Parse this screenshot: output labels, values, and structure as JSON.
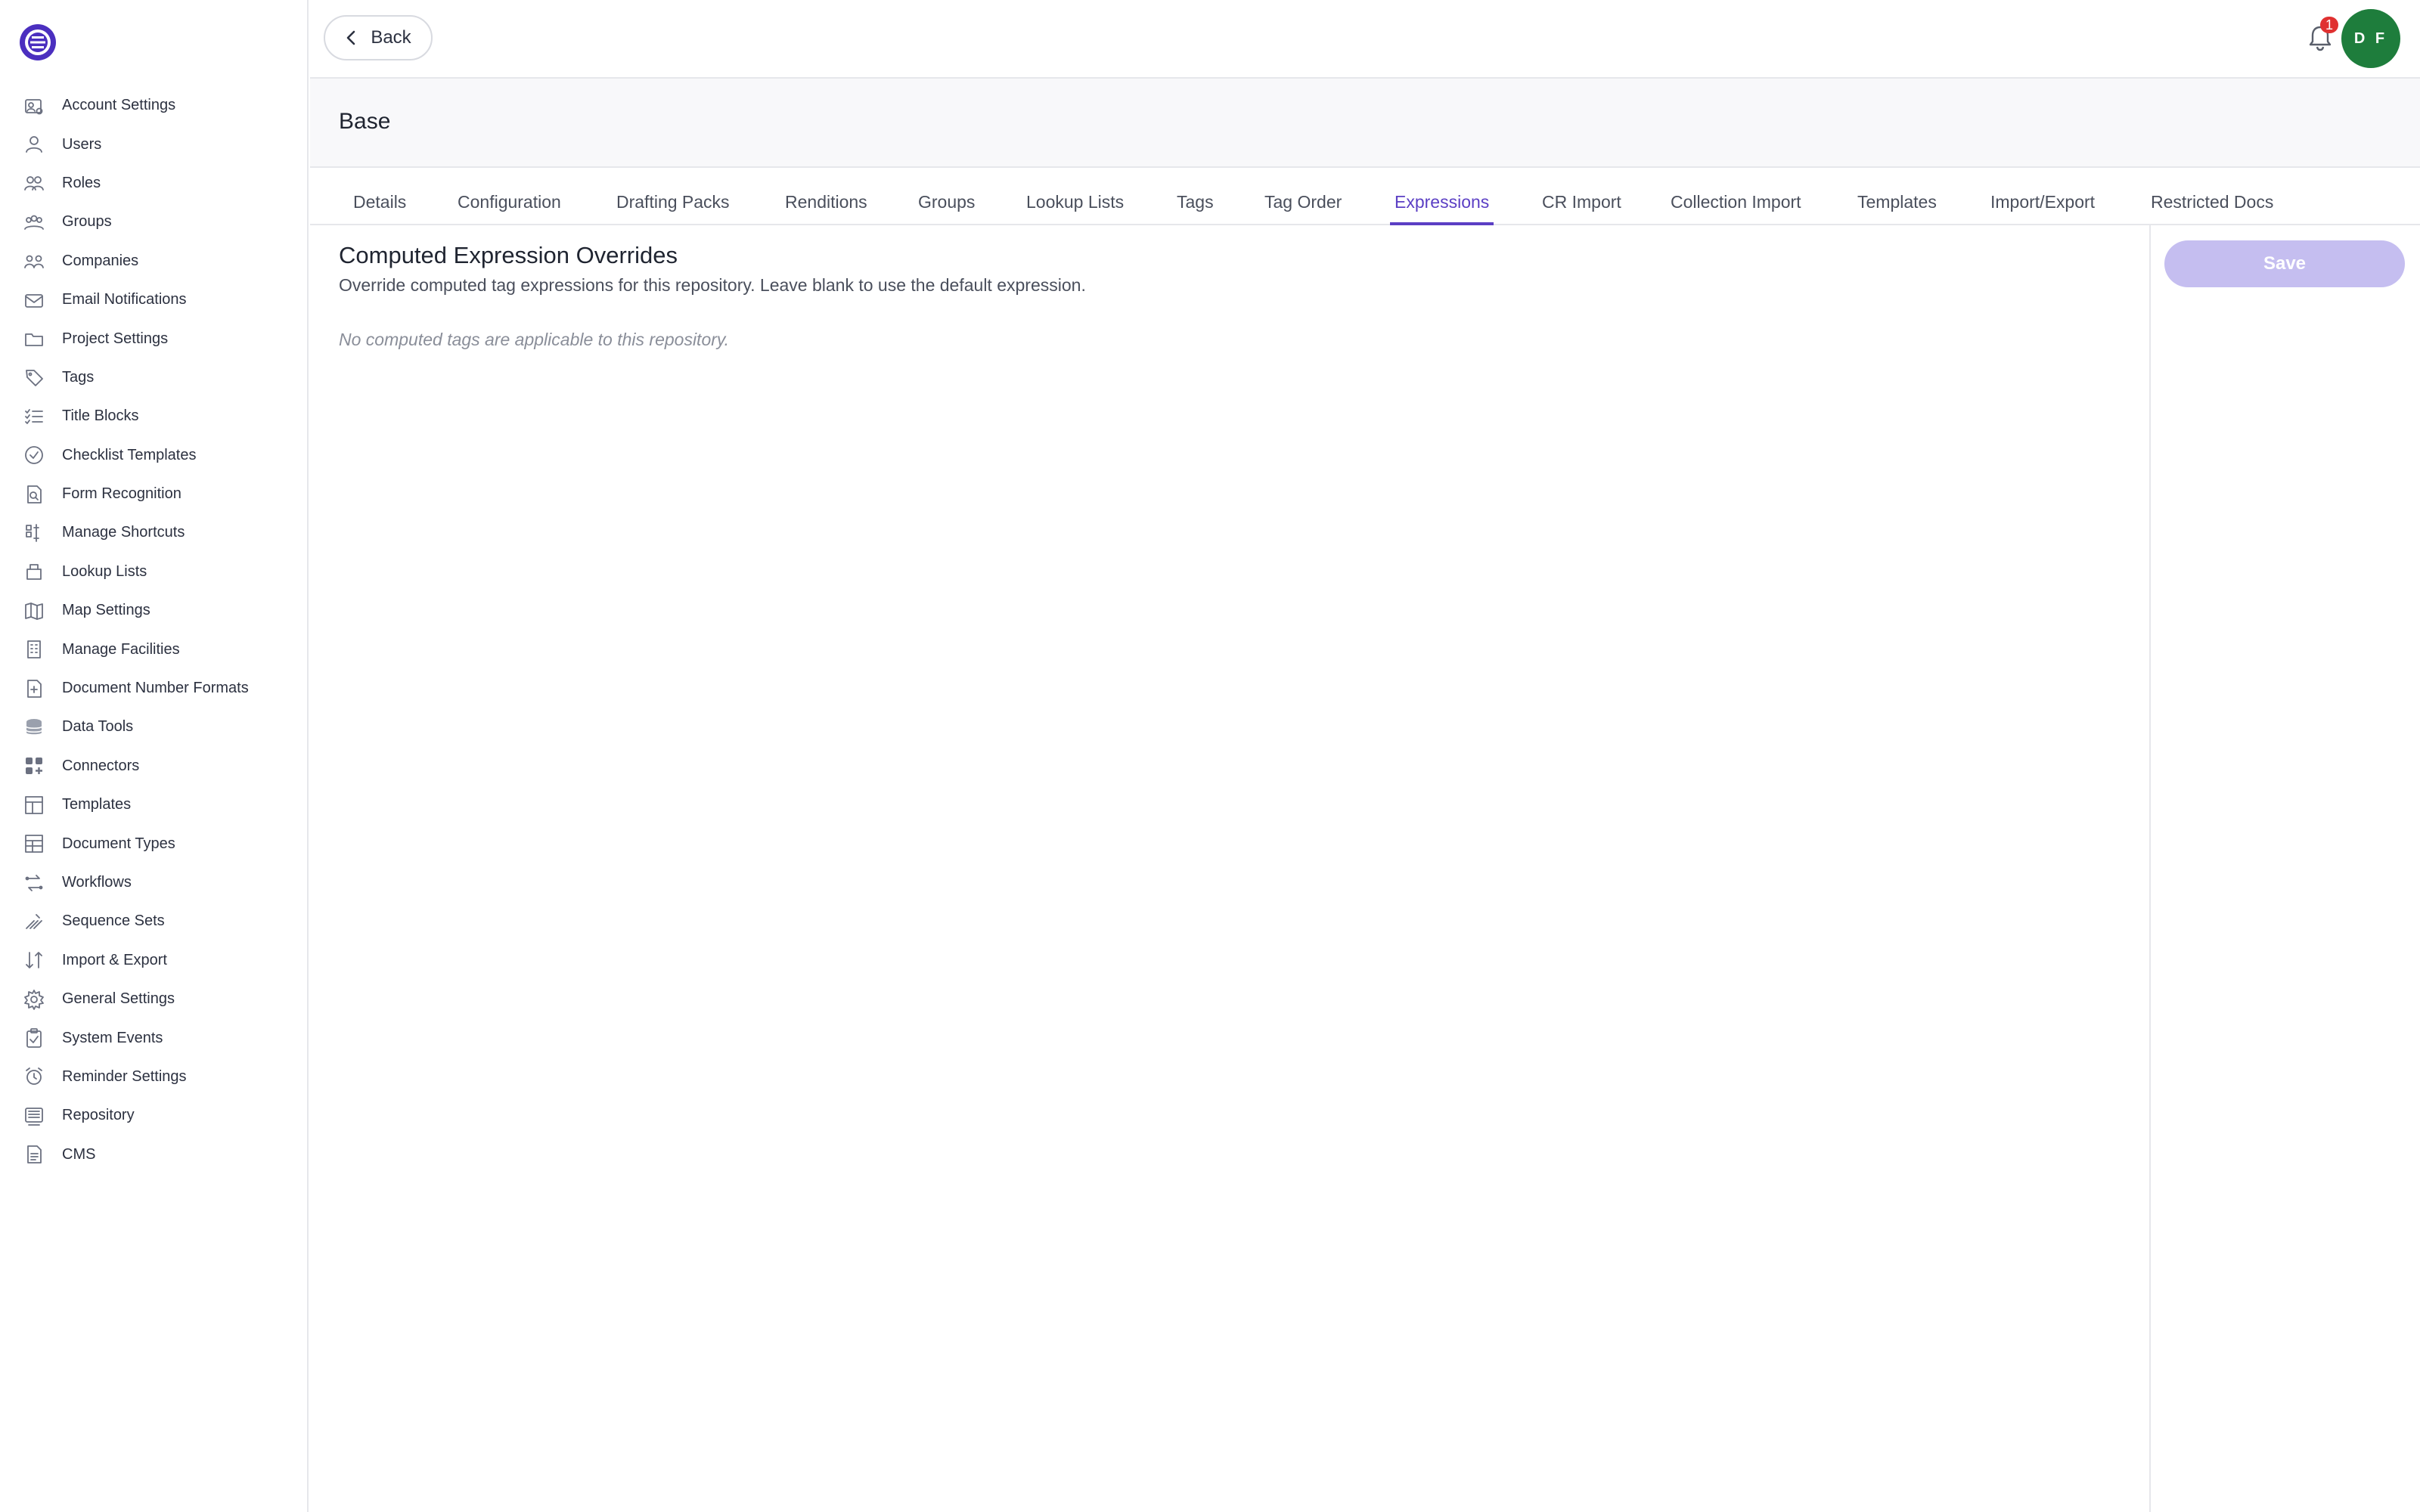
{
  "sidebar": {
    "items": [
      {
        "label": "Account Settings",
        "icon": "account-settings-icon"
      },
      {
        "label": "Users",
        "icon": "user-icon"
      },
      {
        "label": "Roles",
        "icon": "roles-icon"
      },
      {
        "label": "Groups",
        "icon": "groups-icon"
      },
      {
        "label": "Companies",
        "icon": "companies-icon"
      },
      {
        "label": "Email Notifications",
        "icon": "envelope-icon"
      },
      {
        "label": "Project Settings",
        "icon": "folder-icon"
      },
      {
        "label": "Tags",
        "icon": "tag-icon"
      },
      {
        "label": "Title Blocks",
        "icon": "checklist-lines-icon"
      },
      {
        "label": "Checklist Templates",
        "icon": "check-circle-icon"
      },
      {
        "label": "Form Recognition",
        "icon": "document-search-icon"
      },
      {
        "label": "Manage Shortcuts",
        "icon": "shortcuts-icon"
      },
      {
        "label": "Lookup Lists",
        "icon": "lookup-icon"
      },
      {
        "label": "Map Settings",
        "icon": "map-icon"
      },
      {
        "label": "Manage Facilities",
        "icon": "building-icon"
      },
      {
        "label": "Document Number Formats",
        "icon": "document-add-icon"
      },
      {
        "label": "Data Tools",
        "icon": "database-icon"
      },
      {
        "label": "Connectors",
        "icon": "connectors-icon"
      },
      {
        "label": "Templates",
        "icon": "template-icon"
      },
      {
        "label": "Document Types",
        "icon": "document-types-icon"
      },
      {
        "label": "Workflows",
        "icon": "workflow-icon"
      },
      {
        "label": "Sequence Sets",
        "icon": "sequence-icon"
      },
      {
        "label": "Import & Export",
        "icon": "arrows-up-down-icon"
      },
      {
        "label": "General Settings",
        "icon": "gear-icon"
      },
      {
        "label": "System Events",
        "icon": "clipboard-check-icon"
      },
      {
        "label": "Reminder Settings",
        "icon": "alarm-clock-icon"
      },
      {
        "label": "Repository",
        "icon": "repository-icon"
      },
      {
        "label": "CMS",
        "icon": "document-icon"
      }
    ]
  },
  "header": {
    "back_label": "Back",
    "notification_count": "1",
    "avatar_initials": "D F",
    "avatar_color": "#1e7d3c"
  },
  "page": {
    "title": "Base"
  },
  "tabs": [
    {
      "label": "Details",
      "active": false
    },
    {
      "label": "Configuration",
      "active": false
    },
    {
      "label": "Drafting Packs",
      "active": false
    },
    {
      "label": "Renditions",
      "active": false
    },
    {
      "label": "Groups",
      "active": false
    },
    {
      "label": "Lookup Lists",
      "active": false
    },
    {
      "label": "Tags",
      "active": false
    },
    {
      "label": "Tag Order",
      "active": false
    },
    {
      "label": "Expressions",
      "active": true
    },
    {
      "label": "CR Import",
      "active": false
    },
    {
      "label": "Collection Import",
      "active": false
    },
    {
      "label": "Templates",
      "active": false
    },
    {
      "label": "Import/Export",
      "active": false
    },
    {
      "label": "Restricted Docs",
      "active": false
    }
  ],
  "main": {
    "section_title": "Computed Expression Overrides",
    "section_description": "Override computed tag expressions for this repository. Leave blank to use the default expression.",
    "empty_message": "No computed tags are applicable to this repository.",
    "save_label": "Save"
  },
  "colors": {
    "accent": "#5b3fc4",
    "save_disabled": "#c5bef0",
    "badge": "#e03131"
  }
}
